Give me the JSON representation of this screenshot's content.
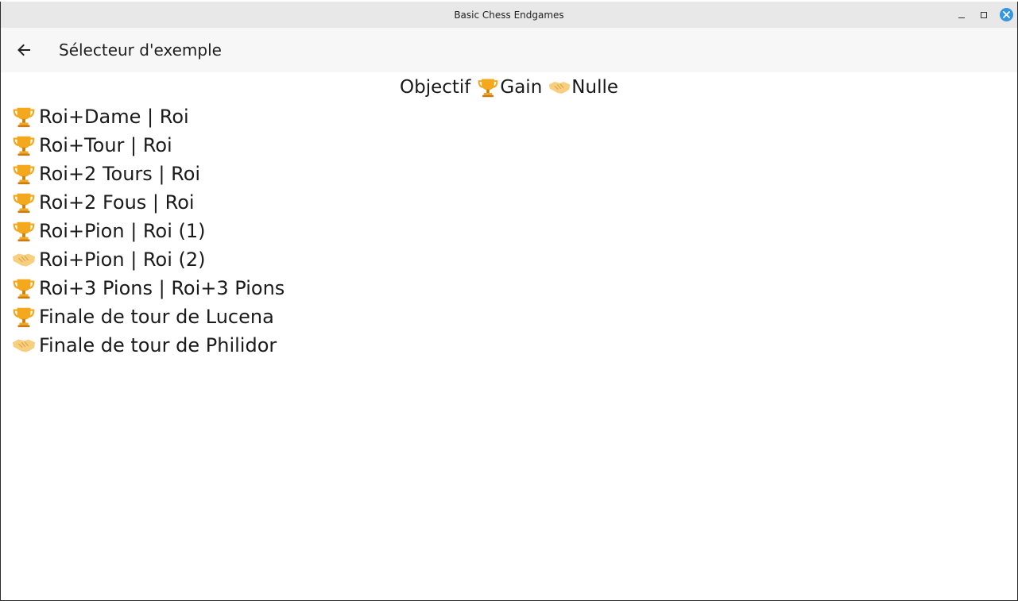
{
  "window": {
    "title": "Basic Chess Endgames"
  },
  "appbar": {
    "title": "Sélecteur d'exemple",
    "back_icon": "arrow-left-icon"
  },
  "legend": {
    "prefix": "Objectif",
    "win_label": "Gain",
    "draw_label": "Nulle",
    "win_icon": "trophy-icon",
    "draw_icon": "handshake-icon"
  },
  "examples": [
    {
      "label": "Roi+Dame | Roi",
      "goal": "win"
    },
    {
      "label": "Roi+Tour | Roi",
      "goal": "win"
    },
    {
      "label": "Roi+2 Tours | Roi",
      "goal": "win"
    },
    {
      "label": "Roi+2 Fous | Roi",
      "goal": "win"
    },
    {
      "label": "Roi+Pion | Roi (1)",
      "goal": "win"
    },
    {
      "label": "Roi+Pion | Roi (2)",
      "goal": "draw"
    },
    {
      "label": "Roi+3 Pions | Roi+3 Pions",
      "goal": "win"
    },
    {
      "label": "Finale de tour de Lucena",
      "goal": "win"
    },
    {
      "label": "Finale de tour de Philidor",
      "goal": "draw"
    }
  ],
  "colors": {
    "trophy": "#f4a81d",
    "trophy_dark": "#c97d11",
    "handshake": "#f7cf7e",
    "close_button": "#3597e0"
  }
}
